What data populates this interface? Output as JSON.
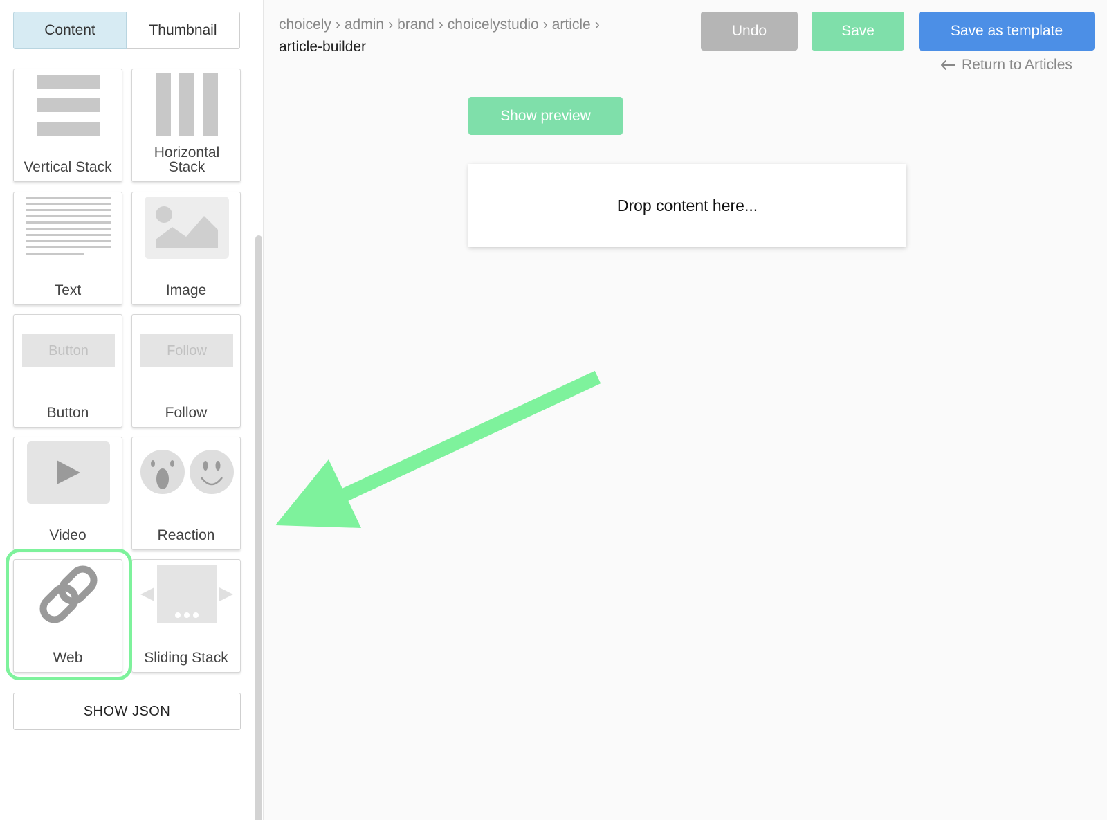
{
  "sidebar": {
    "tabs": [
      {
        "label": "Content"
      },
      {
        "label": "Thumbnail"
      }
    ],
    "tiles": [
      {
        "label": "Vertical Stack",
        "icon": "vertical-stack-icon"
      },
      {
        "label": "Horizontal Stack",
        "icon": "horizontal-stack-icon"
      },
      {
        "label": "Text",
        "icon": "text-lines-icon"
      },
      {
        "label": "Image",
        "icon": "image-icon"
      },
      {
        "label": "Button",
        "icon": "button-preview-icon",
        "preview_text": "Button"
      },
      {
        "label": "Follow",
        "icon": "follow-preview-icon",
        "preview_text": "Follow"
      },
      {
        "label": "Video",
        "icon": "play-icon"
      },
      {
        "label": "Reaction",
        "icon": "reaction-faces-icon"
      },
      {
        "label": "Web",
        "icon": "link-icon"
      },
      {
        "label": "Sliding Stack",
        "icon": "sliding-stack-icon"
      }
    ],
    "show_json_label": "SHOW JSON"
  },
  "header": {
    "breadcrumb": [
      "choicely",
      "admin",
      "brand",
      "choicelystudio",
      "article"
    ],
    "current_page": "article-builder",
    "undo_label": "Undo",
    "save_label": "Save",
    "save_template_label": "Save as template",
    "return_label": "Return to Articles"
  },
  "main": {
    "show_preview_label": "Show preview",
    "dropzone_text": "Drop content here..."
  },
  "colors": {
    "highlight": "#7ef29c",
    "annotation_arrow": "#7ef29c",
    "save_green": "#7fdfaa",
    "template_blue": "#4c8fe6",
    "undo_gray": "#b5b5b5",
    "active_tab": "#d7ebf3"
  }
}
